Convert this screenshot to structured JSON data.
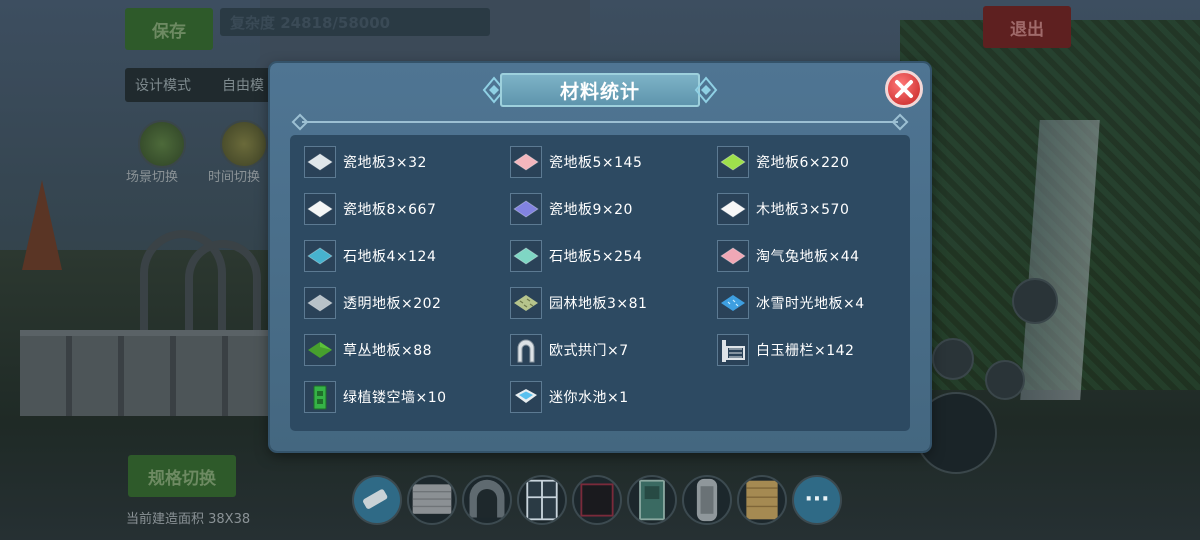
{
  "hud": {
    "save_label": "保存",
    "complexity_text": "复杂度 24818/58000",
    "mode_design": "设计模式",
    "mode_free": "自由模",
    "scene_switch": "场景切换",
    "time_switch": "时间切换",
    "exit_label": "退出",
    "spec_switch": "规格切换",
    "build_area": "当前建造面积 38X38"
  },
  "dialog": {
    "title": "材料统计",
    "items": [
      {
        "label": "瓷地板3×32",
        "icon": "tile-floor-white-icon",
        "color": "#dfe6ea"
      },
      {
        "label": "瓷地板5×145",
        "icon": "tile-floor-pink-icon",
        "color": "#f3b6bd"
      },
      {
        "label": "瓷地板6×220",
        "icon": "tile-floor-green-icon",
        "color": "#9ee04c"
      },
      {
        "label": "瓷地板8×667",
        "icon": "tile-floor-white-icon",
        "color": "#f4f6f6"
      },
      {
        "label": "瓷地板9×20",
        "icon": "tile-floor-purple-icon",
        "color": "#8283e0"
      },
      {
        "label": "木地板3×570",
        "icon": "wood-floor-icon",
        "color": "#f7f7f7"
      },
      {
        "label": "石地板4×124",
        "icon": "stone-floor-cyan-icon",
        "color": "#47b3cf"
      },
      {
        "label": "石地板5×254",
        "icon": "stone-floor-mint-icon",
        "color": "#7fd6c4"
      },
      {
        "label": "淘气兔地板×44",
        "icon": "rabbit-floor-icon",
        "color": "#f0a8b6"
      },
      {
        "label": "透明地板×202",
        "icon": "transparent-floor-icon",
        "color": "#b8c2c8"
      },
      {
        "label": "园林地板3×81",
        "icon": "garden-floor-icon",
        "color": "#b6c48c"
      },
      {
        "label": "冰雪时光地板×4",
        "icon": "ice-floor-icon",
        "color": "#3e9fe0"
      },
      {
        "label": "草丛地板×88",
        "icon": "grass-floor-icon",
        "color": "#47a02e"
      },
      {
        "label": "欧式拱门×7",
        "icon": "european-arch-icon",
        "color": "#dde2e6"
      },
      {
        "label": "白玉栅栏×142",
        "icon": "jade-fence-icon",
        "color": "#dfe4e8"
      },
      {
        "label": "绿植镂空墙×10",
        "icon": "green-hollow-wall-icon",
        "color": "#36b347"
      },
      {
        "label": "迷你水池×1",
        "icon": "mini-pool-icon",
        "color": "#59c0ee"
      }
    ]
  },
  "toolbar": {
    "items": [
      "eraser-icon",
      "stone-wall-icon",
      "arch-door-icon",
      "window-icon",
      "dark-block-icon",
      "green-door-icon",
      "stone-pillar-icon",
      "wood-block-icon",
      "more-icon"
    ],
    "more_label": "···"
  }
}
